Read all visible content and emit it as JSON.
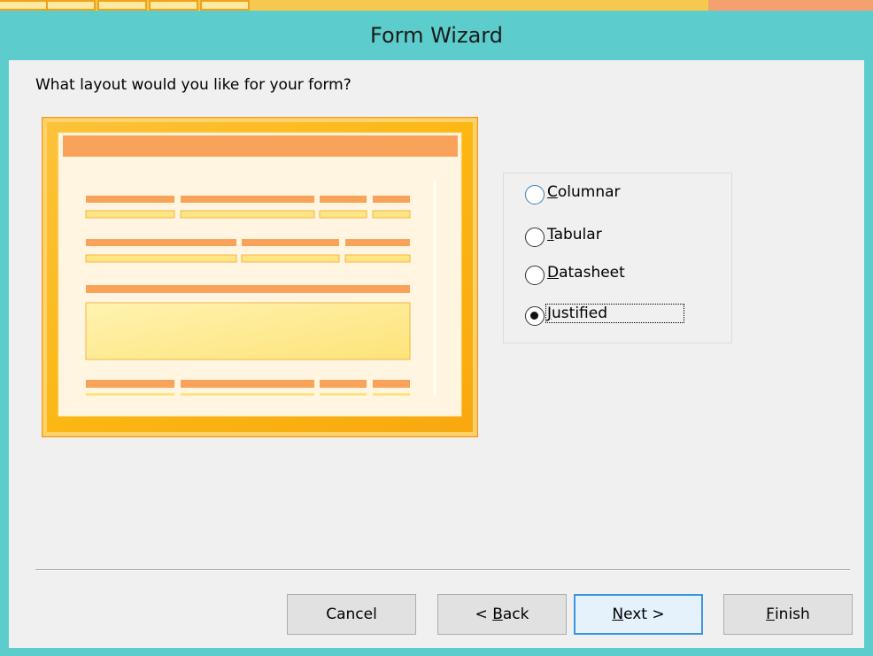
{
  "window": {
    "title": "Form Wizard"
  },
  "prompt": "What layout would you like for your form?",
  "layout_options": {
    "columnar": {
      "accel": "C",
      "rest": "olumnar",
      "selected": false
    },
    "tabular": {
      "accel": "T",
      "rest": "abular",
      "selected": false
    },
    "datasheet": {
      "accel": "D",
      "rest": "atasheet",
      "selected": false
    },
    "justified": {
      "accel": "J",
      "rest": "ustified",
      "selected": true
    }
  },
  "buttons": {
    "cancel": "Cancel",
    "back_prefix": "< ",
    "back_accel": "B",
    "back_rest": "ack",
    "next_accel": "N",
    "next_rest": "ext >",
    "finish_accel": "F",
    "finish_rest": "inish"
  },
  "colors": {
    "titlebar": "#5ccdcc",
    "preview_border": "#f7941d",
    "preview_outer": "#fbb714",
    "preview_inner": "#fff5e0",
    "bar_orange": "#f9a35a",
    "bar_yellow": "#fde584",
    "default_button_border": "#3c95e0"
  }
}
